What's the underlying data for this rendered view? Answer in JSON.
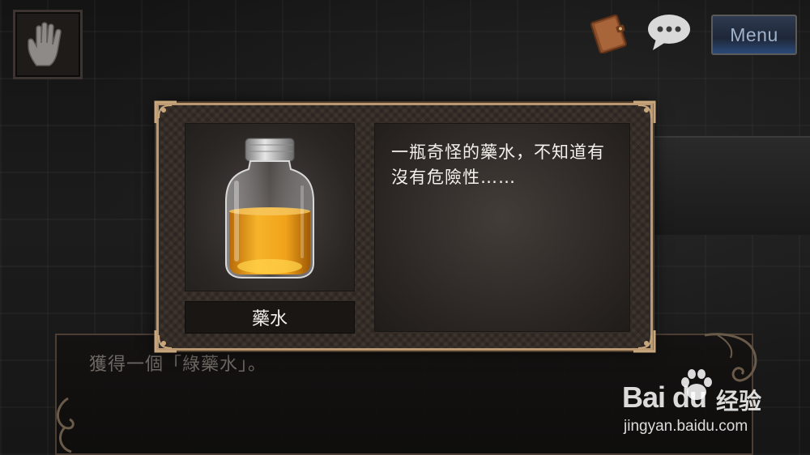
{
  "header": {
    "menu_label": "Menu"
  },
  "icons": {
    "hand": "hand-icon",
    "notebook": "notebook-icon",
    "chat": "chat-bubble-icon"
  },
  "item_dialog": {
    "item_name": "藥水",
    "description": "一瓶奇怪的藥水，不知道有沒有危險性……"
  },
  "message": {
    "text": "獲得一個「綠藥水」。"
  },
  "watermark": {
    "logo_text": "Bai du",
    "cn_text": "经验",
    "url": "jingyan.baidu.com"
  },
  "colors": {
    "frame_gold": "#b99872",
    "potion_amber": "#f0a21a",
    "menu_blue": "#2b4a78"
  }
}
